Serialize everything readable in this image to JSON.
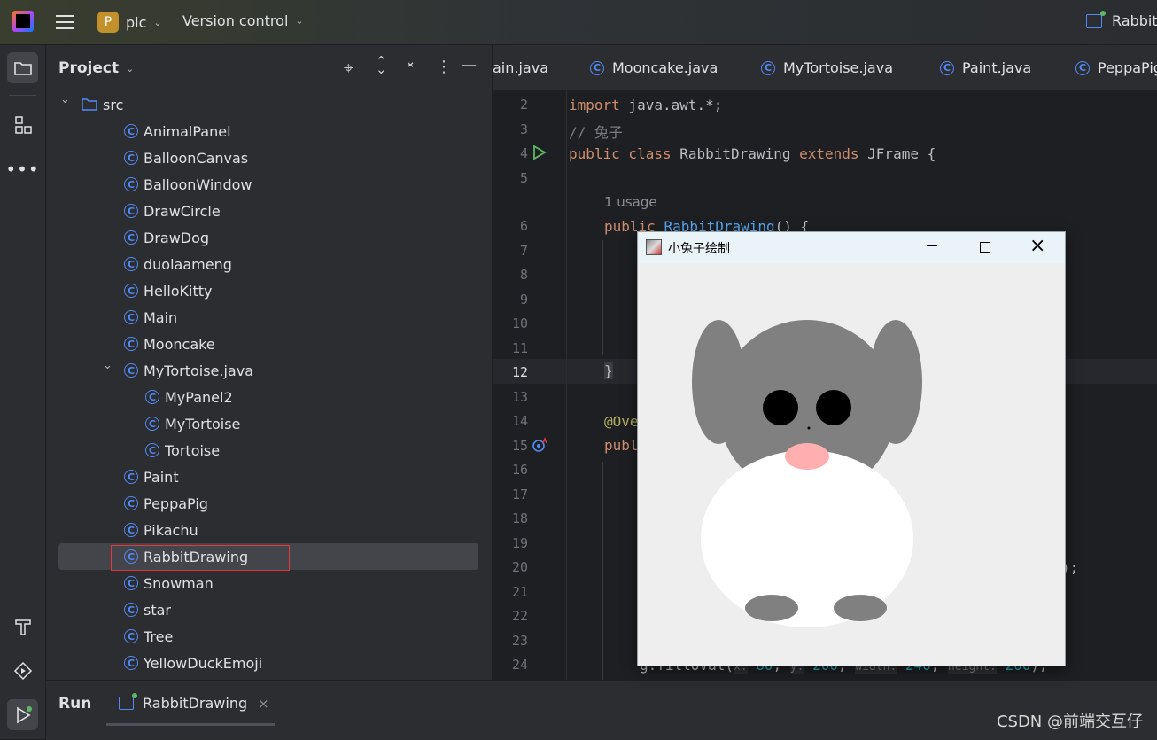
{
  "titlebar": {
    "project_badge": "P",
    "project_name": "pic",
    "vcs_menu": "Version control",
    "run_config": "RabbitD"
  },
  "project_panel": {
    "title": "Project",
    "tree": [
      {
        "label": "src",
        "type": "folder",
        "expanded": true,
        "depth": 0
      },
      {
        "label": "AnimalPanel",
        "type": "class",
        "depth": 1
      },
      {
        "label": "BalloonCanvas",
        "type": "class",
        "depth": 1
      },
      {
        "label": "BalloonWindow",
        "type": "class",
        "depth": 1
      },
      {
        "label": "DrawCircle",
        "type": "class",
        "depth": 1
      },
      {
        "label": "DrawDog",
        "type": "class",
        "depth": 1
      },
      {
        "label": "duolaameng",
        "type": "class",
        "depth": 1
      },
      {
        "label": "HelloKitty",
        "type": "class",
        "depth": 1
      },
      {
        "label": "Main",
        "type": "class",
        "depth": 1
      },
      {
        "label": "Mooncake",
        "type": "class",
        "depth": 1
      },
      {
        "label": "MyTortoise.java",
        "type": "file",
        "expanded": true,
        "depth": 1
      },
      {
        "label": "MyPanel2",
        "type": "class",
        "depth": 2
      },
      {
        "label": "MyTortoise",
        "type": "class",
        "depth": 2
      },
      {
        "label": "Tortoise",
        "type": "class",
        "depth": 2
      },
      {
        "label": "Paint",
        "type": "class",
        "depth": 1
      },
      {
        "label": "PeppaPig",
        "type": "class",
        "depth": 1
      },
      {
        "label": "Pikachu",
        "type": "class",
        "depth": 1
      },
      {
        "label": "RabbitDrawing",
        "type": "class",
        "depth": 1,
        "selected": true
      },
      {
        "label": "Snowman",
        "type": "class",
        "depth": 1
      },
      {
        "label": "star",
        "type": "class",
        "depth": 1
      },
      {
        "label": "Tree",
        "type": "class",
        "depth": 1
      },
      {
        "label": "YellowDuckEmoji",
        "type": "class",
        "depth": 1
      }
    ]
  },
  "editor": {
    "tabs": [
      "ain.java",
      "Mooncake.java",
      "MyTortoise.java",
      "Paint.java",
      "PeppaPig"
    ],
    "line_numbers": [
      "2",
      "3",
      "4",
      "5",
      "6",
      "7",
      "8",
      "9",
      "10",
      "11",
      "12",
      "13",
      "14",
      "15",
      "16",
      "17",
      "18",
      "19",
      "20",
      "21",
      "22",
      "23",
      "24"
    ],
    "code": {
      "l2_kw": "import",
      "l2_rest": " java.awt.*;",
      "l3": "// 兔子",
      "l4_kw1": "public class",
      "l4_name": " RabbitDrawing ",
      "l4_kw2": "extends",
      "l4_rest": " JFrame {",
      "usage_hint": "1 usage",
      "l6_kw": "public",
      "l6_fn": "RabbitDrawing",
      "l6_rest": "() {",
      "l12": "}",
      "l14": "@Ove",
      "l15": "publ",
      "l20_tail": ");",
      "l24": "g.fillOval(",
      "l24_hint_x": "x:",
      "l24_x": "80",
      "l24_hint_y": "y:",
      "l24_y": "200",
      "l24_hint_w": "width:",
      "l24_w": "240",
      "l24_hint_h": "height:",
      "l24_h": "200",
      "l24_tail": ");"
    }
  },
  "bottom_panel": {
    "run_label": "Run",
    "run_tab": "RabbitDrawing"
  },
  "app_window": {
    "title": "小兔子绘制"
  },
  "watermark": "CSDN @前端交互仔",
  "colors": {
    "accent": "#548af7",
    "selection_border": "#e0383e",
    "rabbit_gray": "#808080",
    "rabbit_nose": "#ffafaf"
  }
}
